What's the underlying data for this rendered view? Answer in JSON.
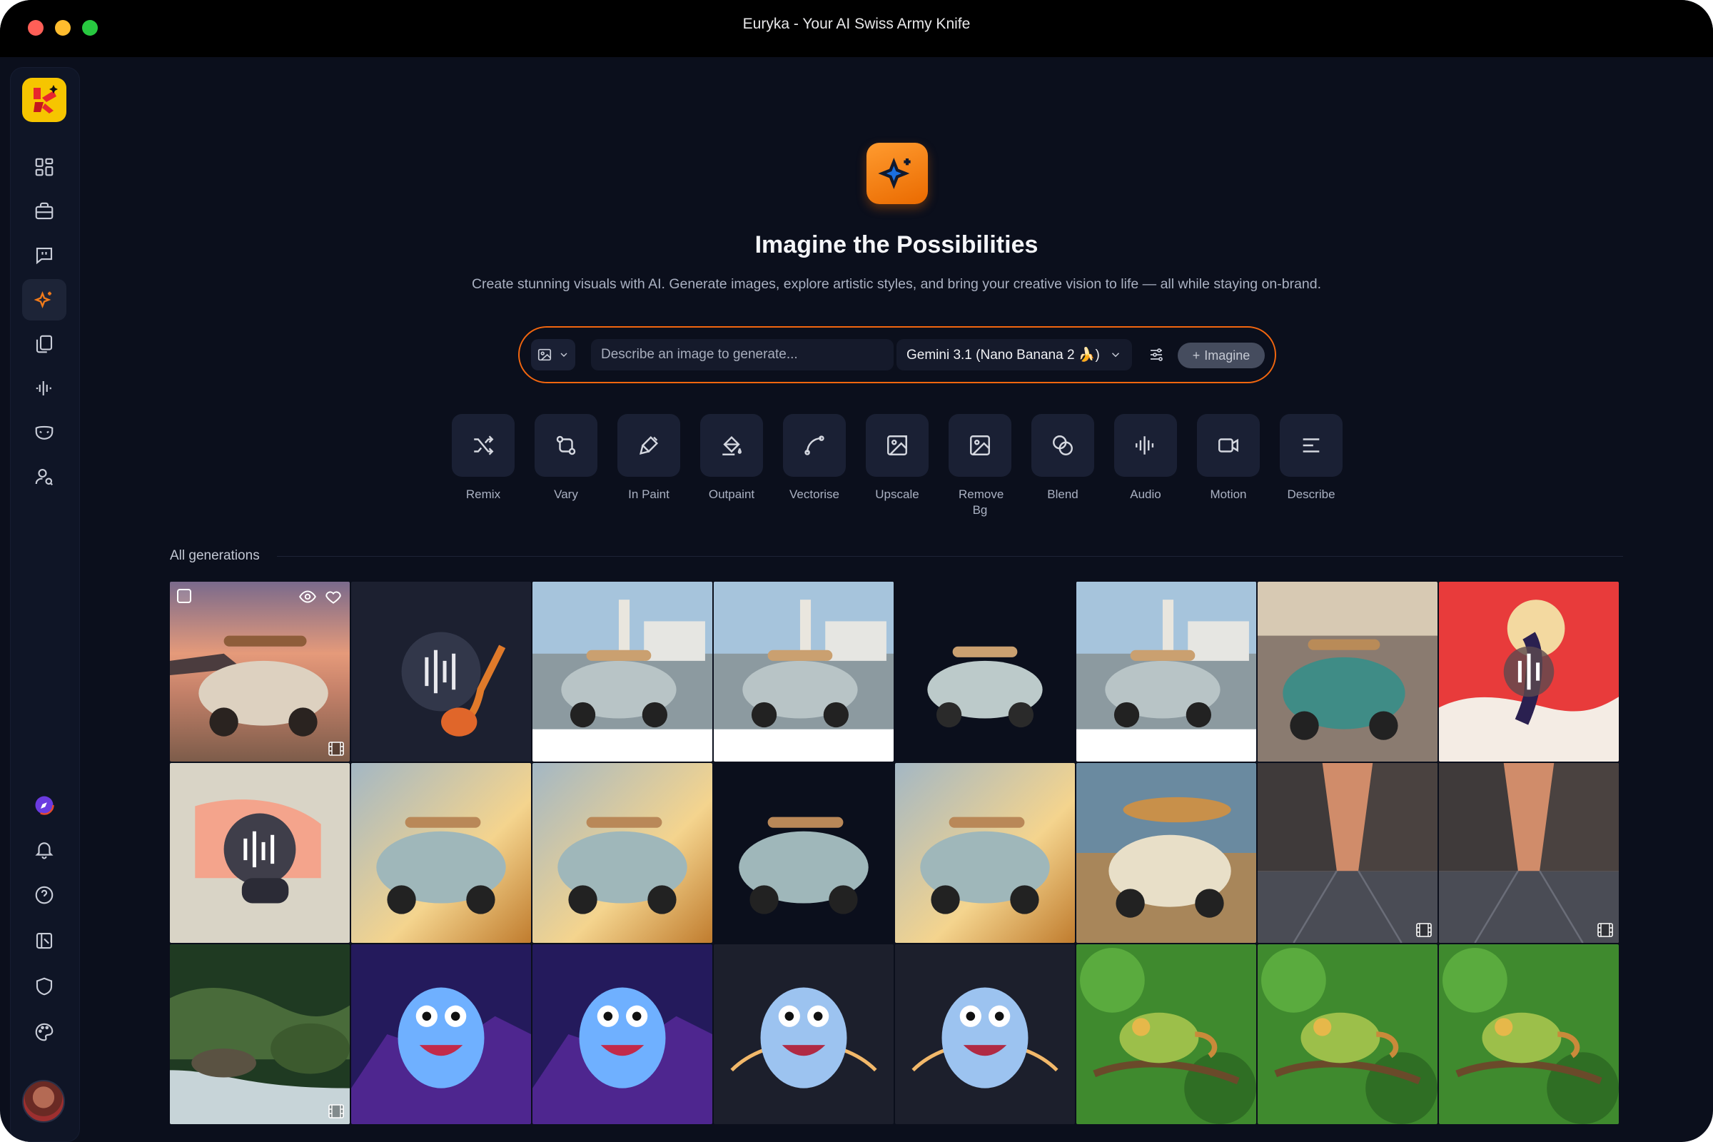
{
  "window": {
    "title": "Euryka - Your AI Swiss Army Knife"
  },
  "sidebar": {
    "logo_icon": "euryka-logo-icon",
    "top_items": [
      {
        "name": "dashboard",
        "icon": "grid-icon"
      },
      {
        "name": "toolkit",
        "icon": "briefcase-icon"
      },
      {
        "name": "chat",
        "icon": "chat-quote-icon"
      },
      {
        "name": "imagine",
        "icon": "sparkles-icon",
        "active": true
      },
      {
        "name": "documents",
        "icon": "copy-icon"
      },
      {
        "name": "audio",
        "icon": "waveform-icon"
      },
      {
        "name": "brand",
        "icon": "mask-icon"
      },
      {
        "name": "personas",
        "icon": "user-search-icon"
      }
    ],
    "bottom_items": [
      {
        "name": "explore",
        "icon": "compass-icon"
      },
      {
        "name": "notifications",
        "icon": "bell-icon"
      },
      {
        "name": "help",
        "icon": "help-circle-icon"
      },
      {
        "name": "library",
        "icon": "library-icon"
      },
      {
        "name": "security",
        "icon": "shield-icon"
      },
      {
        "name": "themes",
        "icon": "palette-icon"
      }
    ],
    "avatar_icon": "user-avatar"
  },
  "hero": {
    "icon": "sparkles-icon",
    "title": "Imagine the Possibilities",
    "subtitle": "Create stunning visuals with AI. Generate images, explore artistic styles, and bring your creative vision to life — all while staying on-brand."
  },
  "prompt": {
    "type_icon": "image-icon",
    "placeholder": "Describe an image to generate...",
    "model": "Gemini 3.1 (Nano Banana 2 🍌)",
    "settings_icon": "sliders-icon",
    "submit_label": "Imagine"
  },
  "tools": [
    {
      "label": "Remix",
      "icon": "shuffle-icon"
    },
    {
      "label": "Vary",
      "icon": "git-compare-icon"
    },
    {
      "label": "In Paint",
      "icon": "paintbrush-icon"
    },
    {
      "label": "Outpaint",
      "icon": "paint-bucket-icon"
    },
    {
      "label": "Vectorise",
      "icon": "bezier-curve-icon"
    },
    {
      "label": "Upscale",
      "icon": "image-upscale-icon"
    },
    {
      "label": "Remove Bg",
      "icon": "image-remove-icon"
    },
    {
      "label": "Blend",
      "icon": "blend-icon"
    },
    {
      "label": "Audio",
      "icon": "audio-lines-icon"
    },
    {
      "label": "Motion",
      "icon": "video-icon"
    },
    {
      "label": "Describe",
      "icon": "text-align-icon"
    }
  ],
  "gallery": {
    "section_label": "All generations",
    "tiles": [
      {
        "kind": "beetle-sunset-beach",
        "video": true,
        "hover": true
      },
      {
        "kind": "audio-guitar-dark",
        "video": false
      },
      {
        "kind": "beetle-lighthouse",
        "video": false
      },
      {
        "kind": "beetle-lighthouse",
        "video": false
      },
      {
        "kind": "beetle-cutout-dark",
        "video": false
      },
      {
        "kind": "beetle-lighthouse",
        "video": false
      },
      {
        "kind": "beetle-teal-coast",
        "video": false
      },
      {
        "kind": "audio-guitarist-red",
        "video": false
      },
      {
        "kind": "audio-drummer-beige",
        "video": false
      },
      {
        "kind": "beetle-golden",
        "video": false
      },
      {
        "kind": "beetle-golden",
        "video": false
      },
      {
        "kind": "beetle-golden-dark",
        "video": false
      },
      {
        "kind": "beetle-golden",
        "video": false
      },
      {
        "kind": "beetle-cream-surfboard",
        "video": false
      },
      {
        "kind": "cobblestone-street",
        "video": true
      },
      {
        "kind": "cobblestone-street",
        "video": true
      },
      {
        "kind": "forest-stream",
        "video": true
      },
      {
        "kind": "monster-neon",
        "video": false
      },
      {
        "kind": "monster-neon",
        "video": false
      },
      {
        "kind": "monster-holo",
        "video": false
      },
      {
        "kind": "monster-holo",
        "video": false
      },
      {
        "kind": "chameleon-jungle",
        "video": false
      },
      {
        "kind": "chameleon-jungle",
        "video": false
      },
      {
        "kind": "chameleon-jungle",
        "video": false
      }
    ]
  }
}
